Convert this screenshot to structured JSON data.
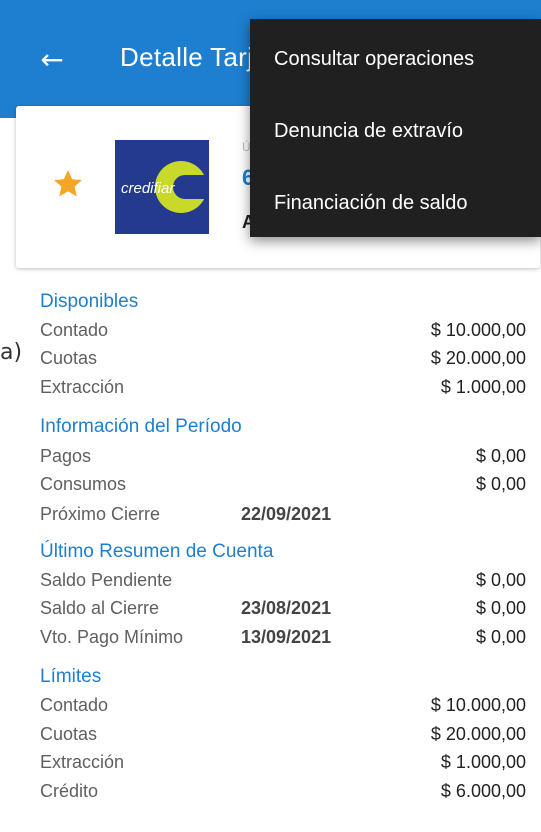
{
  "appbar": {
    "title": "Detalle Tarjeta",
    "back_icon": "arrow-left-icon",
    "background": "#1e7fd0"
  },
  "card": {
    "favorite_icon": "star-icon",
    "star_color": "#f5a623",
    "logo_text": "credifiar",
    "truncated_label": "Ú",
    "truncated_number": "6",
    "truncated_holder": "A"
  },
  "stray_text": "a)",
  "sections": [
    {
      "title": "Disponibles",
      "rows": [
        {
          "label": "Contado",
          "date": "",
          "amount": "$ 10.000,00"
        },
        {
          "label": "Cuotas",
          "date": "",
          "amount": "$ 20.000,00"
        },
        {
          "label": "Extracción",
          "date": "",
          "amount": "$ 1.000,00"
        }
      ]
    },
    {
      "title": "Información del Período",
      "rows": [
        {
          "label": "Pagos",
          "date": "",
          "amount": "$ 0,00"
        },
        {
          "label": "Consumos",
          "date": "",
          "amount": "$ 0,00"
        },
        {
          "label": "Próximo Cierre",
          "date": "22/09/2021",
          "amount": ""
        }
      ]
    },
    {
      "title": "Último Resumen de Cuenta",
      "rows": [
        {
          "label": "Saldo Pendiente",
          "date": "",
          "amount": "$ 0,00"
        },
        {
          "label": "Saldo al Cierre",
          "date": "23/08/2021",
          "amount": "$ 0,00"
        },
        {
          "label": "Vto. Pago Mínimo",
          "date": "13/09/2021",
          "amount": "$ 0,00"
        }
      ]
    },
    {
      "title": "Límites",
      "rows": [
        {
          "label": "Contado",
          "date": "",
          "amount": "$ 10.000,00"
        },
        {
          "label": "Cuotas",
          "date": "",
          "amount": "$ 20.000,00"
        },
        {
          "label": "Extracción",
          "date": "",
          "amount": "$ 1.000,00"
        },
        {
          "label": "Crédito",
          "date": "",
          "amount": "$ 6.000,00"
        }
      ]
    }
  ],
  "menu": {
    "items": [
      {
        "label": "Consultar operaciones"
      },
      {
        "label": "Denuncia de extravío"
      },
      {
        "label": "Financiación de saldo"
      }
    ]
  }
}
